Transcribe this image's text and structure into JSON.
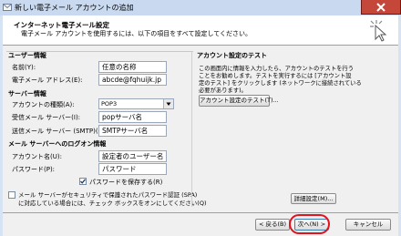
{
  "window": {
    "title": "新しい電子メール アカウントの追加"
  },
  "header": {
    "title": "インターネット電子メール設定",
    "subtitle": "電子メール アカウントを使用するには、以下の項目をすべて設定してください。"
  },
  "user_info": {
    "section": "ユーザー情報",
    "name_label": "名前(Y):",
    "name_value": "任意の名称",
    "email_label": "電子メール アドレス(E):",
    "email_value": "abcde@fqhuijk.jp"
  },
  "server_info": {
    "section": "サーバー情報",
    "account_type_label": "アカウントの種類(A):",
    "account_type_value": "POP3",
    "incoming_label": "受信メール サーバー(I):",
    "incoming_value": "popサーバ名",
    "outgoing_label": "送信メール サーバー (SMTP)(O):",
    "outgoing_value": "SMTPサーバ名"
  },
  "logon_info": {
    "section": "メール サーバーへのログオン情報",
    "account_label": "アカウント名(U):",
    "account_value": "設定者のユーザー名",
    "password_label": "パスワード(P):",
    "password_value": "パスワード",
    "save_password_label": "パスワードを保存する(R)",
    "save_password_checked": true,
    "spa_label_line1": "メール サーバーがセキュリティで保護されたパスワード認証 (SPA)",
    "spa_label_line2": "に対応している場合には、チェック ボックスをオンにしてください(Q)",
    "spa_checked": false
  },
  "test": {
    "section": "アカウント設定のテスト",
    "description_line1": "この画面内に情報を入力したら、アカウントのテストを行う",
    "description_line2": "ことをお勧めします。テストを実行するには [アカウント設",
    "description_line3": "定のテスト] をクリックします (ネットワークに接続されている",
    "description_line4": "必要があります)。",
    "test_button": "アカウント設定のテスト(T)..."
  },
  "details_button": "詳細設定(M)...",
  "footer": {
    "back": "< 戻る(B)",
    "next": "次へ(N) >",
    "cancel": "キャンセル"
  },
  "colors": {
    "titlebar": "#c9daf0",
    "close_button": "#c4473a",
    "highlight_ring": "#e0141e",
    "panel": "#f0f0f0"
  }
}
